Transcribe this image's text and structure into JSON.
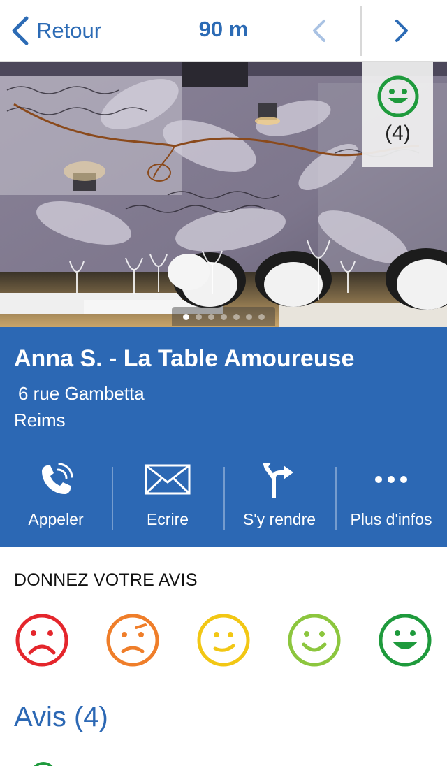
{
  "nav": {
    "back_label": "Retour",
    "distance": "90 m",
    "icons": {
      "back": "chevron-left-icon",
      "prev": "chevron-left-icon",
      "next": "chevron-right-icon"
    }
  },
  "photo": {
    "rating_icon": "happy-face-icon",
    "rating_count": "(4)",
    "pager": {
      "total": 7,
      "active": 1
    }
  },
  "place": {
    "name": "Anna S. - La Table Amoureuse",
    "street": "6 rue Gambetta",
    "city": "Reims"
  },
  "actions": [
    {
      "label": "Appeler",
      "icon": "phone-icon"
    },
    {
      "label": "Ecrire",
      "icon": "envelope-icon"
    },
    {
      "label": "S'y rendre",
      "icon": "directions-icon"
    },
    {
      "label": "Plus d'infos",
      "icon": "more-icon"
    }
  ],
  "review_prompt": {
    "title": "DONNEZ VOTRE AVIS",
    "faces": [
      {
        "mood": "very-bad",
        "icon": "sad-face-icon",
        "color": "#e4262c"
      },
      {
        "mood": "bad",
        "icon": "unhappy-face-icon",
        "color": "#ef7e2a"
      },
      {
        "mood": "neutral",
        "icon": "neutral-face-icon",
        "color": "#f2c714"
      },
      {
        "mood": "good",
        "icon": "smile-face-icon",
        "color": "#8cc63e"
      },
      {
        "mood": "very-good",
        "icon": "happy-face-icon",
        "color": "#1e9a3c"
      }
    ]
  },
  "reviews": {
    "title": "Avis (4)"
  },
  "colors": {
    "accent": "#2c68b4",
    "nav_blue": "#2c6bb5",
    "rating_green": "#1e9a3c"
  }
}
